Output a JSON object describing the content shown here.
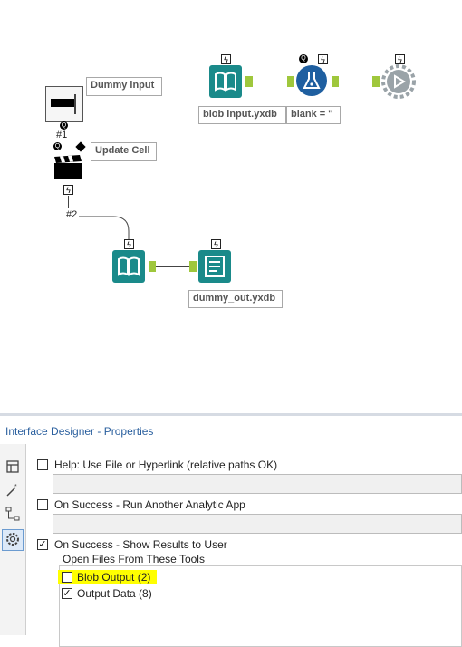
{
  "canvas": {
    "annotations": {
      "dummy_input": "Dummy input",
      "update_cell": "Update Cell",
      "blob_input": "blob input.yxdb",
      "blank": "blank = ''",
      "dummy_out": "dummy_out.yxdb"
    },
    "labels": {
      "tool1": "#1",
      "tool2": "#2"
    },
    "colors": {
      "teal": "#1a8a8a",
      "blue": "#1f5fa0",
      "connector": "#9fc73c"
    }
  },
  "panel": {
    "title": "Interface Designer - Properties",
    "options": {
      "help": "Help: Use File or Hyperlink (relative paths OK)",
      "run_another": "On Success - Run Another Analytic App",
      "show_results": "On Success - Show Results to User",
      "open_files_group": "Open Files From These Tools",
      "blob_output": "Blob Output (2)",
      "output_data": "Output Data (8)"
    }
  }
}
